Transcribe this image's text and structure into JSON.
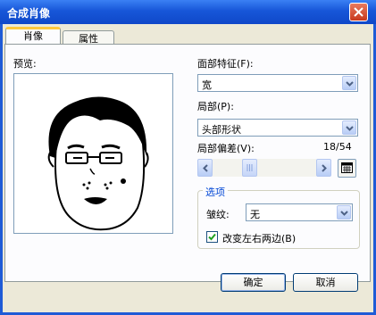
{
  "window": {
    "title": "合成肖像"
  },
  "tabs": [
    {
      "label": "肖像"
    },
    {
      "label": "属性"
    }
  ],
  "preview": {
    "label": "预览:"
  },
  "face_feature": {
    "label": "面部特征(F):",
    "value": "宽"
  },
  "part": {
    "label": "局部(P):",
    "value": "头部形状"
  },
  "offset": {
    "label": "局部偏差(V):",
    "readout": "18/54",
    "current": 18,
    "max": 54
  },
  "options": {
    "title": "选项",
    "wrinkle_label": "皱纹:",
    "wrinkle_value": "无",
    "mirror_label": "改变左右两边(B)",
    "mirror_checked": true
  },
  "buttons": {
    "ok": "确定",
    "cancel": "取消"
  },
  "colors": {
    "title_bar": "#0f48c9",
    "dialog_bg": "#ece9d8",
    "active_tab_accent": "#ffc83c",
    "group_title": "#0046d5"
  }
}
